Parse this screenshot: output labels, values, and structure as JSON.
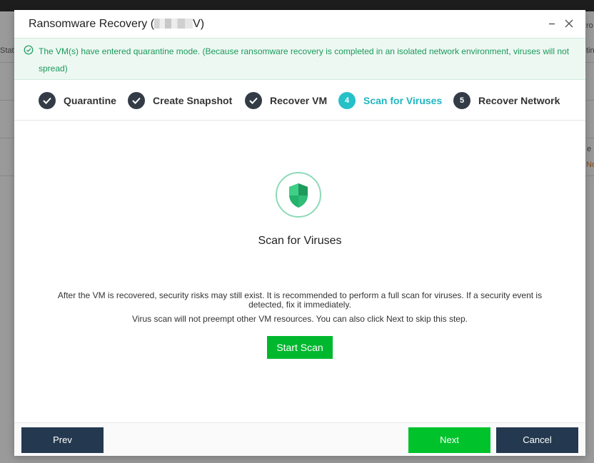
{
  "background": {
    "left_fragment": "Stat",
    "right_fragment_1": "ro",
    "right_fragment_2": "tin",
    "right_fragment_3": "e",
    "right_fragment_4": "No"
  },
  "dialog": {
    "title_prefix": "Ransomware Recovery (",
    "title_suffix": "V)",
    "minimize_icon": "minimize-icon",
    "close_icon": "close-icon"
  },
  "notice": {
    "icon": "check-circle-icon",
    "text": "The VM(s) have entered quarantine mode. (Because ransomware recovery is completed in an isolated network environment, viruses will not spread)"
  },
  "steps": [
    {
      "label": "Quarantine",
      "status": "done",
      "number": ""
    },
    {
      "label": "Create Snapshot",
      "status": "done",
      "number": ""
    },
    {
      "label": "Recover VM",
      "status": "done",
      "number": ""
    },
    {
      "label": "Scan for Viruses",
      "status": "active",
      "number": "4"
    },
    {
      "label": "Recover Network",
      "status": "pending",
      "number": "5"
    }
  ],
  "content": {
    "icon": "shield-icon",
    "title": "Scan for Viruses",
    "description": "After the VM is recovered, security risks may still exist. It is recommended to perform a full scan for viruses. If a security event is detected, fix it immediately.",
    "note": "Virus scan will not preempt other VM resources. You can also click Next to skip this step.",
    "start_scan_label": "Start Scan"
  },
  "footer": {
    "prev_label": "Prev",
    "next_label": "Next",
    "cancel_label": "Cancel"
  },
  "colors": {
    "accent": "#26c0c8",
    "success_green": "#00c22a",
    "dark_button": "#24394f",
    "notice_text": "#1a9a5a"
  }
}
